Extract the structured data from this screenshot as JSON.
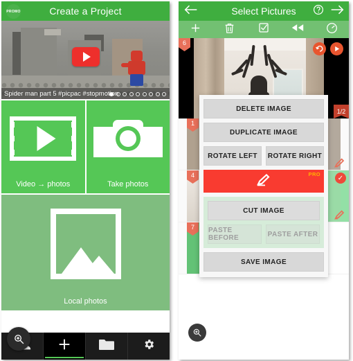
{
  "left_panel": {
    "logo_text": "PROMO",
    "header_title": "Create a Project",
    "featured": {
      "caption": "Spider man part 5 #picpac #stopmotion",
      "play_icon": "youtube-play-icon",
      "dots_total": 9,
      "dots_active_index": 0
    },
    "tiles": [
      {
        "label": "Video → photos",
        "icon": "film-strip-icon"
      },
      {
        "label": "Take photos",
        "icon": "camera-icon"
      },
      {
        "label": "Local photos",
        "icon": "gallery-image-icon"
      }
    ],
    "bottom_nav": {
      "zoom_fab_icon": "magnifier-plus-icon",
      "items": [
        {
          "icon": "community-people-icon",
          "selected": false
        },
        {
          "icon": "plus-icon",
          "selected": true
        },
        {
          "icon": "folder-icon",
          "selected": false
        },
        {
          "icon": "gear-icon",
          "selected": false
        }
      ]
    }
  },
  "right_panel": {
    "header": {
      "back_icon": "arrow-left-icon",
      "title": "Select Pictures",
      "help_icon": "question-mark-icon",
      "next_icon": "arrow-right-icon"
    },
    "toolbar": [
      {
        "icon": "plus-icon"
      },
      {
        "icon": "trash-icon"
      },
      {
        "icon": "select-all-checkbox-icon"
      },
      {
        "icon": "rewind-icon"
      },
      {
        "icon": "speed-gauge-icon"
      }
    ],
    "preview": {
      "badge_number": "6",
      "frame_counter": "1/2",
      "undo_icon": "undo-icon",
      "play_icon": "play-icon"
    },
    "thumbnails": [
      {
        "badge": "1",
        "edit_icon": "pencil-icon",
        "selected": false
      },
      {
        "badge": "",
        "edit_icon": "pencil-icon",
        "selected": false
      },
      {
        "badge": "4",
        "edit_icon": "pencil-icon",
        "selected": false
      },
      {
        "badge": "",
        "edit_icon": "pencil-icon",
        "selected": true,
        "check_icon": "check-icon"
      },
      {
        "badge": "7",
        "edit_icon": "pencil-icon",
        "selected": false
      },
      {
        "badge": "",
        "edit_icon": "",
        "selected": false
      }
    ],
    "context_menu": {
      "delete_image": "DELETE IMAGE",
      "duplicate_image": "DUPLICATE IMAGE",
      "rotate_left": "ROTATE LEFT",
      "rotate_right": "ROTATE RIGHT",
      "draw_icon": "pencil-draw-icon",
      "pro_tag": "PRO",
      "cut_image": "CUT IMAGE",
      "paste_before": "PASTE BEFORE",
      "paste_after": "PASTE AFTER",
      "save_image": "SAVE IMAGE"
    },
    "zoom_fab_icon": "magnifier-plus-icon"
  },
  "colors": {
    "header_green": "#3fae3f",
    "tile_green": "#55c756",
    "muted_green": "#7fbd7f",
    "toolbar_green": "#72c072",
    "pro_red": "#f93b30",
    "badge_orange": "#e8705a",
    "nav_dark": "#1c1c1c"
  }
}
